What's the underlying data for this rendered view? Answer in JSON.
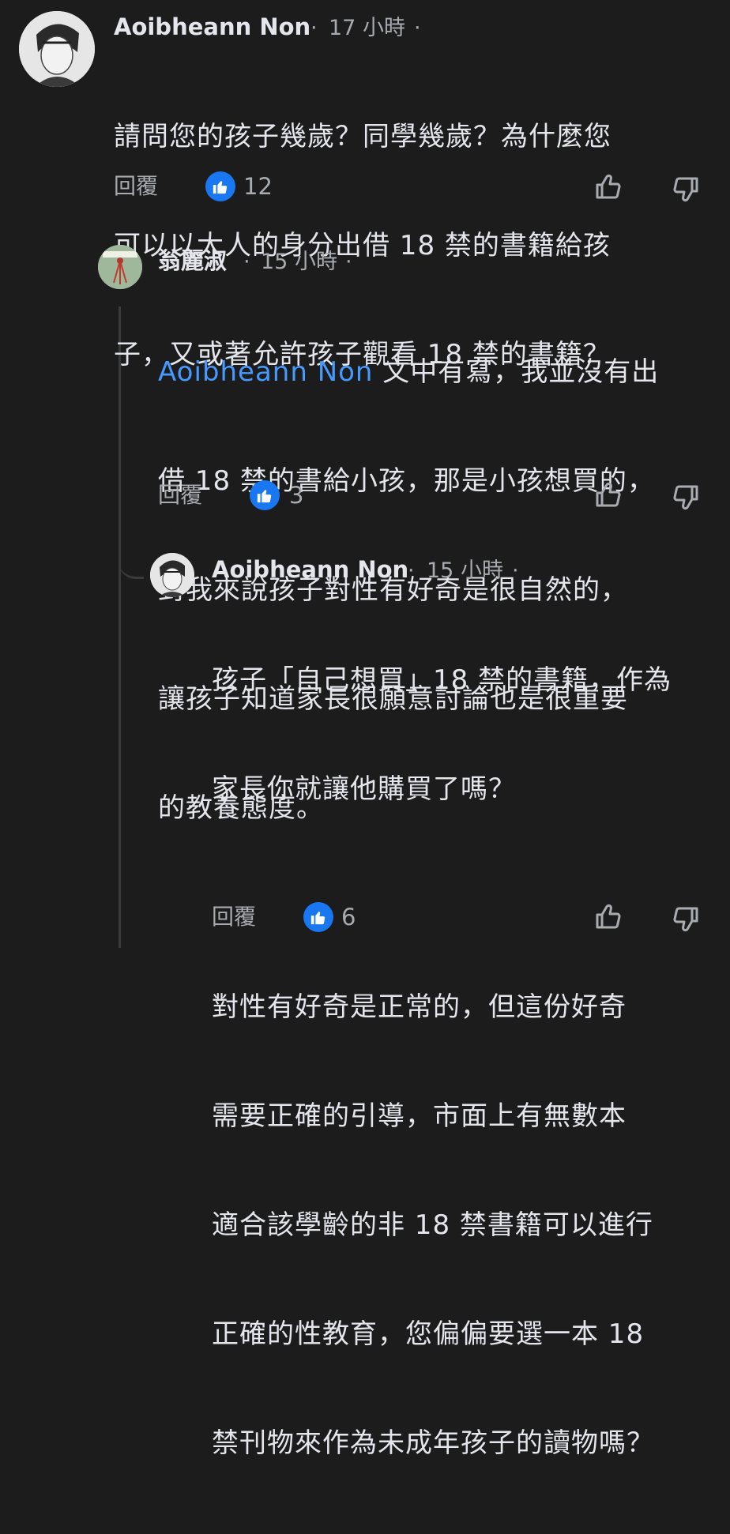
{
  "comments": [
    {
      "author": "Aoibheann Non",
      "dot1": "·",
      "time": "17 小時",
      "dot2": "·",
      "lines": [
        "請問您的孩子幾歲？同學幾歲？為什麼您",
        "可以以大人的身分出借 18 禁的書籍給孩",
        "子，又或著允許孩子觀看 18 禁的書籍？"
      ],
      "reply_label": "回覆",
      "like_count": "12"
    },
    {
      "author": "翁麗淑",
      "dot1": "·",
      "time": "15 小時",
      "dot2": "·",
      "mention": "Aoibheann Non",
      "lines": [
        " 文中有寫，我並沒有出",
        "借 18 禁的書給小孩，那是小孩想買的，",
        "對我來說孩子對性有好奇是很自然的，",
        "讓孩子知道家長很願意討論也是很重要",
        "的教養態度。"
      ],
      "reply_label": "回覆",
      "like_count": "3"
    },
    {
      "author": "Aoibheann Non",
      "dot1": "·",
      "time": "15 小時",
      "dot2": "·",
      "lines": [
        "孩子「自己想買」18 禁的書籍，作為",
        "家長你就讓他購買了嗎？",
        "",
        "對性有好奇是正常的，但這份好奇",
        "需要正確的引導，市面上有無數本",
        "適合該學齡的非 18 禁書籍可以進行",
        "正確的性教育，您偏偏要選一本 18",
        "禁刊物來作為未成年孩子的讀物嗎？"
      ],
      "reply_label": "回覆",
      "like_count": "6"
    }
  ],
  "icons": {
    "like_badge": "thumbs-up-icon",
    "upvote": "arrow-up-icon",
    "downvote": "arrow-down-icon"
  },
  "colors": {
    "background": "#1c1c1d",
    "mention": "#4599ff",
    "like_badge": "#1a77f2",
    "secondary_text": "#a8abaf"
  }
}
